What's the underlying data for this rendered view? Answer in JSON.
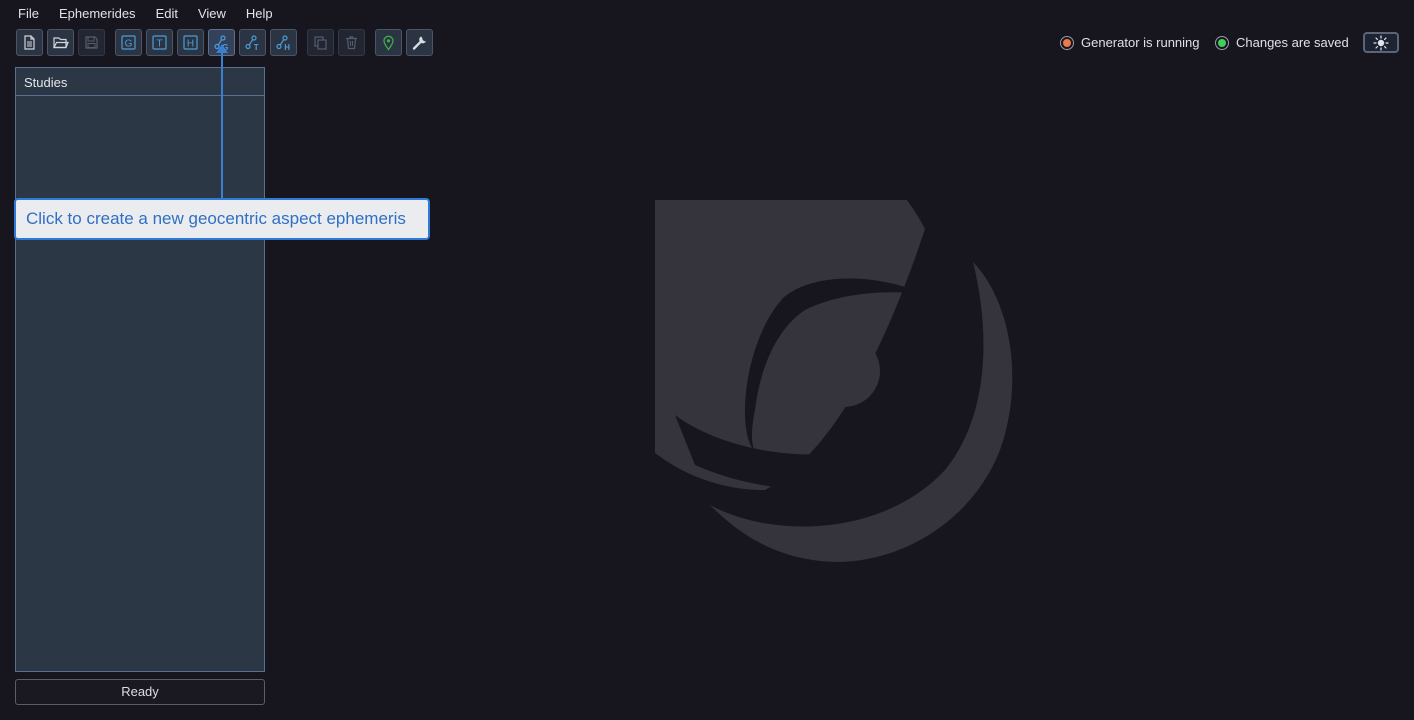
{
  "menu": [
    "File",
    "Ephemerides",
    "Edit",
    "View",
    "Help"
  ],
  "toolbar": {
    "buttons": [
      {
        "name": "new-file-button",
        "icon": "new-file-icon",
        "tooltip": "New file"
      },
      {
        "name": "open-file-button",
        "icon": "open-folder-icon",
        "tooltip": "Open file"
      },
      {
        "name": "save-file-button",
        "icon": "save-icon",
        "tooltip": "Save",
        "disabled": true
      },
      {
        "name": "new-geocentric-ephemeris-button",
        "icon": "letter-g-icon",
        "letter": "G"
      },
      {
        "name": "new-topocentric-ephemeris-button",
        "icon": "letter-t-icon",
        "letter": "T"
      },
      {
        "name": "new-heliocentric-ephemeris-button",
        "icon": "letter-h-icon",
        "letter": "H"
      },
      {
        "name": "new-geocentric-aspect-ephemeris-button",
        "icon": "aspect-g-icon",
        "letter": "G"
      },
      {
        "name": "new-topocentric-aspect-ephemeris-button",
        "icon": "aspect-t-icon",
        "letter": "T"
      },
      {
        "name": "new-heliocentric-aspect-ephemeris-button",
        "icon": "aspect-h-icon",
        "letter": "H"
      },
      {
        "name": "duplicate-button",
        "icon": "copy-icon",
        "disabled": true
      },
      {
        "name": "delete-button",
        "icon": "trash-icon",
        "disabled": true
      },
      {
        "name": "location-button",
        "icon": "map-pin-icon"
      },
      {
        "name": "settings-button",
        "icon": "wrench-icon"
      }
    ]
  },
  "status": {
    "generator": {
      "text": "Generator is running",
      "color": "#f07846"
    },
    "saved": {
      "text": "Changes are saved",
      "color": "#3ed15a"
    }
  },
  "theme_toggle": {
    "icon": "sun-icon"
  },
  "studies": {
    "header": "Studies",
    "items": []
  },
  "statusbar": {
    "text": "Ready"
  },
  "tooltip": {
    "text": "Click to create a new geocentric aspect ephemeris"
  },
  "colors": {
    "background": "#17161f",
    "panel": "#2c3746",
    "accent": "#2f7ad8",
    "icon": "#4a9ed8"
  }
}
